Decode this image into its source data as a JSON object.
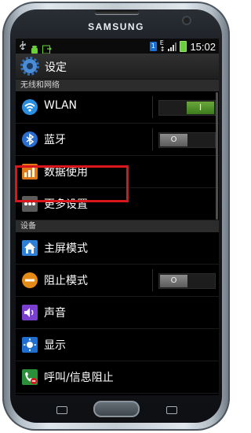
{
  "device": {
    "brand": "SAMSUNG"
  },
  "status_bar": {
    "time": "15:02",
    "sim_label": "1"
  },
  "header": {
    "title": "设定"
  },
  "sections": [
    {
      "title": "无线和网络"
    },
    {
      "title": "设备"
    }
  ],
  "rows": [
    {
      "label": "WLAN",
      "icon": "wifi-icon",
      "toggle": "on",
      "toggle_text": "I"
    },
    {
      "label": "蓝牙",
      "icon": "bluetooth-icon",
      "toggle": "off",
      "toggle_text": "O"
    },
    {
      "label": "数据使用",
      "icon": "data-usage-icon"
    },
    {
      "label": "更多设置",
      "icon": "more-icon",
      "highlighted": true
    },
    {
      "label": "主屏模式",
      "icon": "home-icon"
    },
    {
      "label": "阻止模式",
      "icon": "block-icon",
      "toggle": "off",
      "toggle_text": "O"
    },
    {
      "label": "声音",
      "icon": "sound-icon"
    },
    {
      "label": "显示",
      "icon": "display-icon"
    },
    {
      "label": "呼叫/信息阻止",
      "icon": "call-block-icon"
    }
  ],
  "colors": {
    "accent_green": "#4f8f2b",
    "highlight_red": "#d9161c"
  }
}
